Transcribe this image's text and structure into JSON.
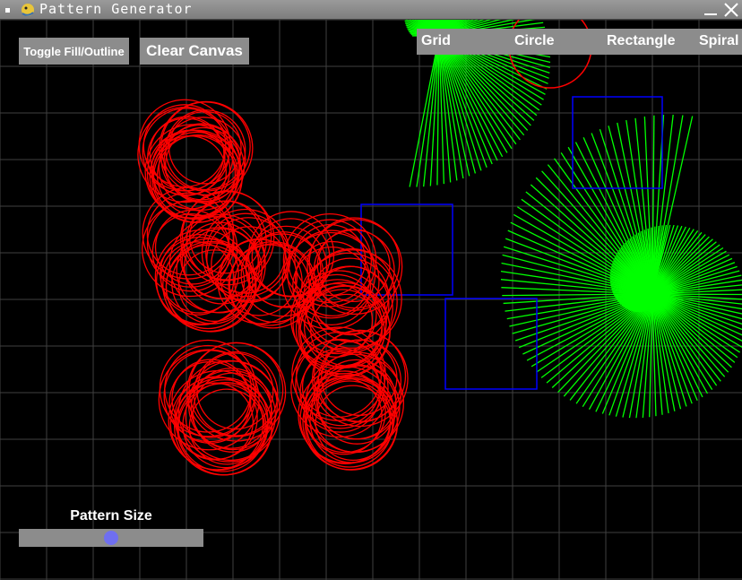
{
  "window": {
    "title": "Pattern Generator"
  },
  "buttons": {
    "toggle": "Toggle Fill/Outline",
    "clear": "Clear Canvas"
  },
  "toolbar": {
    "items": [
      "Grid",
      "Circle",
      "Rectangle",
      "Spiral"
    ]
  },
  "slider": {
    "label": "Pattern Size",
    "value": 0.5
  },
  "colors": {
    "grid": "#404040",
    "circle": "#ff0000",
    "rectangle": "#0000ff",
    "spiral": "#00ff00",
    "button": "#8c8c8c",
    "slider_knob": "#6f6ff0"
  }
}
